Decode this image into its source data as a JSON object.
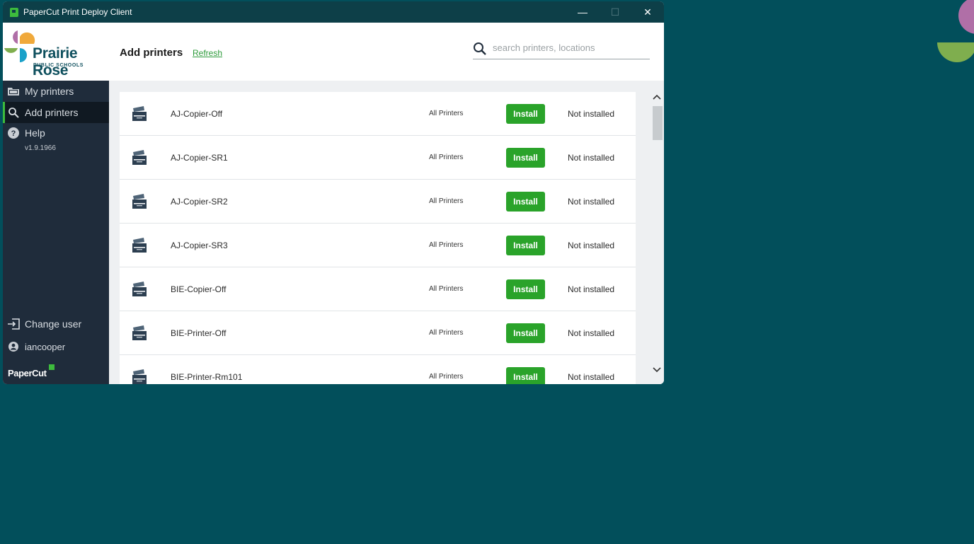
{
  "window": {
    "title": "PaperCut Print Deploy Client",
    "min_glyph": "—",
    "max_glyph": "☐",
    "close_glyph": "✕"
  },
  "header": {
    "logo_name": "Prairie Rose",
    "logo_sub": "PUBLIC SCHOOLS",
    "page_title": "Add printers",
    "refresh_label": "Refresh",
    "search_placeholder": "search printers, locations",
    "search_value": ""
  },
  "sidebar": {
    "items": [
      {
        "label": "My printers",
        "icon": "folder-icon"
      },
      {
        "label": "Add printers",
        "icon": "search-icon",
        "active": true
      },
      {
        "label": "Help",
        "icon": "help-icon"
      }
    ],
    "version": "v1.9.1966",
    "change_user_label": "Change user",
    "username": "iancooper",
    "brand": "PaperCut"
  },
  "printers": [
    {
      "name": "AJ-Copier-Off",
      "group": "All Printers",
      "action": "Install",
      "status": "Not installed"
    },
    {
      "name": "AJ-Copier-SR1",
      "group": "All Printers",
      "action": "Install",
      "status": "Not installed"
    },
    {
      "name": "AJ-Copier-SR2",
      "group": "All Printers",
      "action": "Install",
      "status": "Not installed"
    },
    {
      "name": "AJ-Copier-SR3",
      "group": "All Printers",
      "action": "Install",
      "status": "Not installed"
    },
    {
      "name": "BIE-Copier-Off",
      "group": "All Printers",
      "action": "Install",
      "status": "Not installed"
    },
    {
      "name": "BIE-Printer-Off",
      "group": "All Printers",
      "action": "Install",
      "status": "Not installed"
    },
    {
      "name": "BIE-Printer-Rm101",
      "group": "All Printers",
      "action": "Install",
      "status": "Not installed"
    }
  ],
  "colors": {
    "accent_green": "#2aa32a",
    "sidebar_bg": "#1f2c3b",
    "titlebar_bg": "#0d3f48",
    "desktop_bg": "#024f5b"
  }
}
